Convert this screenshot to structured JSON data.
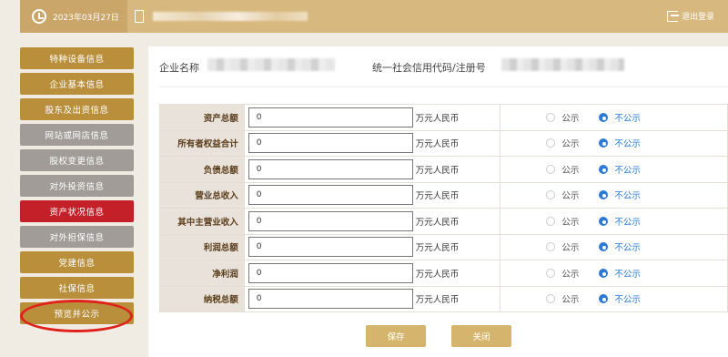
{
  "header": {
    "date": "2023年03月27日",
    "logout_label": "退出登录"
  },
  "sidebar": {
    "items": [
      {
        "label": "特种设备信息",
        "style": "gold"
      },
      {
        "label": "企业基本信息",
        "style": "gold"
      },
      {
        "label": "股东及出资信息",
        "style": "gold"
      },
      {
        "label": "网站或网店信息",
        "style": "gray"
      },
      {
        "label": "股权变更信息",
        "style": "gray"
      },
      {
        "label": "对外投资信息",
        "style": "gray"
      },
      {
        "label": "资产状况信息",
        "style": "red"
      },
      {
        "label": "对外担保信息",
        "style": "gray"
      },
      {
        "label": "党建信息",
        "style": "gold"
      },
      {
        "label": "社保信息",
        "style": "gold"
      },
      {
        "label": "预览并公示",
        "style": "gold"
      }
    ]
  },
  "main": {
    "company_label": "企业名称",
    "credit_label": "统一社会信用代码/注册号",
    "unit": "万元人民币",
    "public_label": "公示",
    "nonpublic_label": "不公示",
    "rows": [
      {
        "label": "资产总额",
        "value": "0"
      },
      {
        "label": "所有者权益合计",
        "value": "0"
      },
      {
        "label": "负债总额",
        "value": "0"
      },
      {
        "label": "营业总收入",
        "value": "0"
      },
      {
        "label": "其中主营业收入",
        "value": "0"
      },
      {
        "label": "利润总额",
        "value": "0"
      },
      {
        "label": "净利润",
        "value": "0"
      },
      {
        "label": "纳税总额",
        "value": "0"
      }
    ],
    "save_label": "保存",
    "close_label": "关闭"
  },
  "colors": {
    "header_bg": "#d7b87e",
    "sidebar_gold": "#b98f3c",
    "sidebar_gray": "#a19c97",
    "sidebar_active": "#c4202a",
    "radio_checked": "#2c7ad6",
    "highlight_oval": "#e0201a"
  },
  "icons": {
    "clock": "clock-icon",
    "document": "document-icon",
    "logout": "logout-icon"
  }
}
